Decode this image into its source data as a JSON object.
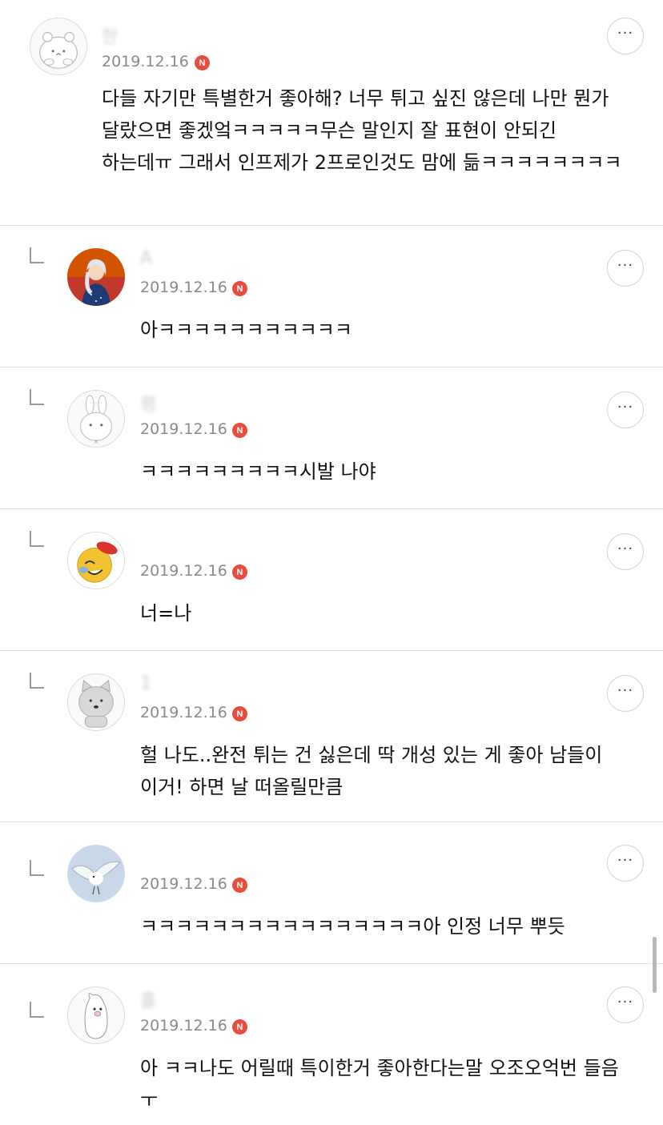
{
  "comments": [
    {
      "name": "한",
      "date": "2019.12.16",
      "badge": "N",
      "text": "다들 자기만 특별한거 좋아해? 너무 튀고 싶진 않은데 나만 뭔가 달랐으면 좋겠엌ㅋㅋㅋㅋㅋ무슨 말인지 잘 표현이 안되긴 하는데ㅠ 그래서 인프제가 2프로인것도 맘에 듦ㅋㅋㅋㅋㅋㅋㅋㅋ",
      "more": "···",
      "avatar_icon": "hamster-icon"
    },
    {
      "name": "A",
      "date": "2019.12.16",
      "badge": "N",
      "text": "아ㅋㅋㅋㅋㅋㅋㅋㅋㅋㅋㅋ",
      "more": "···",
      "avatar_icon": "princess-avatar-icon"
    },
    {
      "name": "평",
      "date": "2019.12.16",
      "badge": "N",
      "text": "ㅋㅋㅋㅋㅋㅋㅋㅋㅋ시발 나야",
      "more": "···",
      "avatar_icon": "rabbit-icon"
    },
    {
      "name": "",
      "date": "2019.12.16",
      "badge": "N",
      "text": "너=나",
      "more": "···",
      "avatar_icon": "emoji-face-icon"
    },
    {
      "name": "1",
      "date": "2019.12.16",
      "badge": "N",
      "text": "헐 나도..완전 튀는 건 싫은데 딱 개성 있는 게 좋아 남들이 이거! 하면 날 떠올릴만큼",
      "more": "···",
      "avatar_icon": "cat-icon"
    },
    {
      "name": "",
      "date": "2019.12.16",
      "badge": "N",
      "text": "ㅋㅋㅋㅋㅋㅋㅋㅋㅋㅋㅋㅋㅋㅋㅋㅋ아 인정 너무 뿌듯",
      "more": "···",
      "avatar_icon": "bird-icon"
    },
    {
      "name": "흘",
      "date": "2019.12.16",
      "badge": "N",
      "text": "아 ㅋㅋ나도 어릴때 특이한거 좋아한다는말 오조오억번 들음 ㅜ",
      "more": "···",
      "avatar_icon": "penguin-icon"
    }
  ]
}
